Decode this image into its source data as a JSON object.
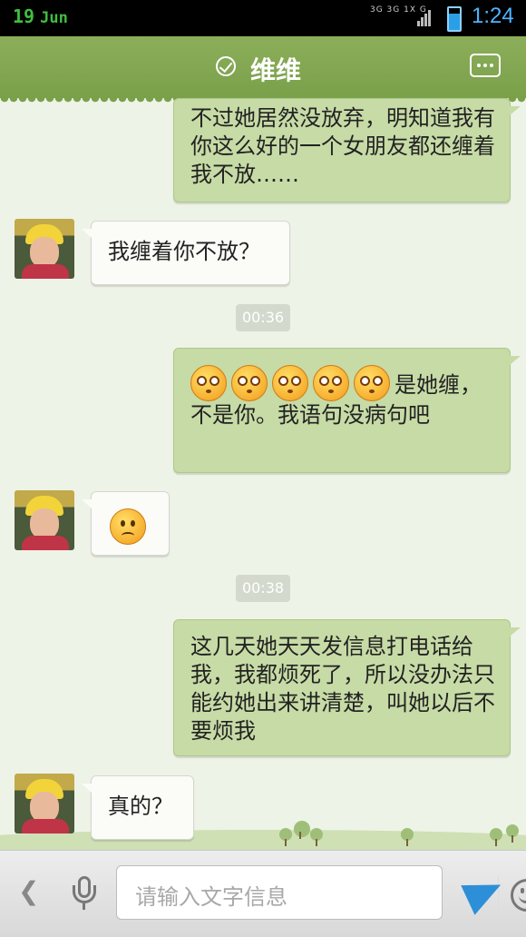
{
  "status_bar": {
    "day": "19",
    "month": "Jun",
    "network": "3G 3G 1X G",
    "time": "1:24"
  },
  "header": {
    "title": "维维",
    "verified_icon": "check-circle-icon",
    "more_icon": "more-dots-icon"
  },
  "messages": {
    "m1": {
      "text": "不过她居然没放弃，明知道我有你这么好的一个女朋友都还缠着我不放……"
    },
    "m2": {
      "text": "我缠着你不放？"
    },
    "t1": "00:36",
    "m3": {
      "emoji_icon": "dizzy-face-icon",
      "emoji_count": 5,
      "text": "是她缠，不是你。我语句没病句吧"
    },
    "m4": {
      "emoji_icon": "confused-face-icon"
    },
    "t2": "00:38",
    "m5": {
      "text": "这几天她天天发信息打电话给我，我都烦死了，所以没办法只能约她出来讲清楚，叫她以后不要烦我"
    },
    "m6": {
      "text": "真的？"
    }
  },
  "input_bar": {
    "placeholder": "请输入文字信息",
    "back_icon": "chevron-left-icon",
    "mic_icon": "microphone-icon",
    "emoji_icon": "smiley-icon",
    "send_icon": "send-icon"
  },
  "colors": {
    "header": "#7aa04a",
    "out_bubble": "#c7dba6",
    "in_bubble": "#fbfbf8",
    "background": "#eef3e7",
    "send": "#2d8fd8"
  }
}
